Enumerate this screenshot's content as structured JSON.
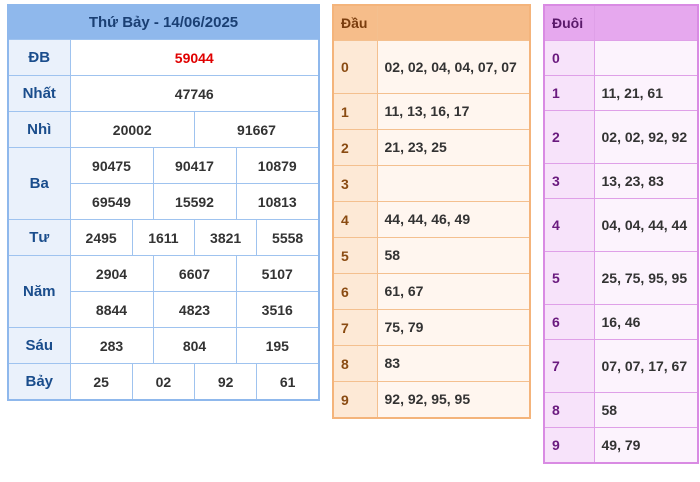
{
  "results": {
    "title": "Thứ Bảy - 14/06/2025",
    "db": {
      "label": "ĐB",
      "values": [
        "59044"
      ]
    },
    "nhat": {
      "label": "Nhất",
      "values": [
        "47746"
      ]
    },
    "nhi": {
      "label": "Nhì",
      "values": [
        "20002",
        "91667"
      ]
    },
    "ba": {
      "label": "Ba",
      "values": [
        "90475",
        "90417",
        "10879",
        "69549",
        "15592",
        "10813"
      ]
    },
    "tu": {
      "label": "Tư",
      "values": [
        "2495",
        "1611",
        "3821",
        "5558"
      ]
    },
    "nam": {
      "label": "Năm",
      "values": [
        "2904",
        "6607",
        "5107",
        "8844",
        "4823",
        "3516"
      ]
    },
    "sau": {
      "label": "Sáu",
      "values": [
        "283",
        "804",
        "195"
      ]
    },
    "bay": {
      "label": "Bảy",
      "values": [
        "25",
        "02",
        "92",
        "61"
      ]
    }
  },
  "dau": {
    "header": "Đầu",
    "rows": [
      {
        "key": "0",
        "value": "02, 02, 04, 04, 07, 07"
      },
      {
        "key": "1",
        "value": "11, 13, 16, 17"
      },
      {
        "key": "2",
        "value": "21, 23, 25"
      },
      {
        "key": "3",
        "value": ""
      },
      {
        "key": "4",
        "value": "44, 44, 46, 49"
      },
      {
        "key": "5",
        "value": "58"
      },
      {
        "key": "6",
        "value": "61, 67"
      },
      {
        "key": "7",
        "value": "75, 79"
      },
      {
        "key": "8",
        "value": "83"
      },
      {
        "key": "9",
        "value": "92, 92, 95, 95"
      }
    ]
  },
  "duoi": {
    "header": "Đuôi",
    "rows": [
      {
        "key": "0",
        "value": ""
      },
      {
        "key": "1",
        "value": "11, 21, 61"
      },
      {
        "key": "2",
        "value": "02, 02, 92, 92"
      },
      {
        "key": "3",
        "value": "13, 23, 83"
      },
      {
        "key": "4",
        "value": "04, 04, 44, 44"
      },
      {
        "key": "5",
        "value": "25, 75, 95, 95"
      },
      {
        "key": "6",
        "value": "16, 46"
      },
      {
        "key": "7",
        "value": "07, 07, 17, 67"
      },
      {
        "key": "8",
        "value": "58"
      },
      {
        "key": "9",
        "value": "49, 79"
      }
    ]
  }
}
